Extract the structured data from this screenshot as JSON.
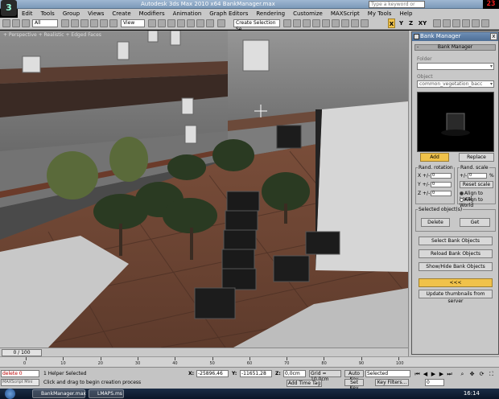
{
  "window": {
    "title": "Autodesk 3ds Max 2010 x64    BankManager.max",
    "search_placeholder": "Type a keyword or phrase",
    "frame_counter": "23"
  },
  "menu": [
    "Edit",
    "Tools",
    "Group",
    "Views",
    "Create",
    "Modifiers",
    "Animation",
    "Graph Editors",
    "Rendering",
    "Customize",
    "MAXScript",
    "My Tools",
    "Help"
  ],
  "toolbar": {
    "selection_filter": "All",
    "ref_coord": "View",
    "named_selection": "Create Selection Se",
    "axis_x": "X",
    "axis_y": "Y",
    "axis_z": "Z",
    "axis_xy": "XY"
  },
  "viewport": {
    "label": "+ Perspective + Realistic + Edged Faces"
  },
  "bank_manager": {
    "title": "Bank Manager",
    "close": "x",
    "rollout": "Bank Manager",
    "rollout_toggle": "-",
    "folder_label": "Folder",
    "folder_value": "",
    "object_label": "Object",
    "object_value": "common_vegetation_bacc",
    "add_button": "Add",
    "replace_button": "Replace",
    "rotation_group": "Rand. rotation",
    "rot_x_label": "X +/-",
    "rot_x": "0",
    "rot_y_label": "Y +/-",
    "rot_y": "0",
    "rot_z_label": "Z +/-",
    "rot_z": "0",
    "scale_group": "Rand. scale",
    "scale_label": "+/-",
    "scale_value": "0",
    "scale_unit": "%",
    "reset_scale": "Reset scale",
    "align_local": "Align to Local",
    "align_world": "Align to World",
    "selected_group": "Selected object(s)",
    "delete_button": "Delete",
    "get_button": "Get",
    "select_bank_objects": "Select Bank Objects",
    "reload_bank_objects": "Reload Bank Objects",
    "show_hide_bank_objects": "Show/Hide Bank Objects",
    "collapse_button": "<<<",
    "update_thumbnails": "Update thumbnails from server"
  },
  "timeline": {
    "time_label": "0 / 100",
    "ticks": [
      "0",
      "10",
      "20",
      "30",
      "40",
      "50",
      "60",
      "70",
      "80",
      "90",
      "100"
    ]
  },
  "status": {
    "selection_field": "delete 0",
    "script_field": "MAXScript Mini",
    "status_text": "1 Helper Selected",
    "prompt_text": "Click and drag to begin creation process",
    "x_label": "X:",
    "x_value": "-25896,46",
    "y_label": "Y:",
    "y_value": "-11651,28",
    "z_label": "Z:",
    "z_value": "0,0cm",
    "grid": "Grid = 10,0cm",
    "add_time_tag": "Add Time Tag",
    "auto_key": "Auto Key",
    "set_key": "Set Key",
    "selected_dropdown": "Selected",
    "key_filters": "Key Filters...",
    "frame_field": "0"
  },
  "taskbar": {
    "items": [
      "BankManager.max",
      "LMAPS.ms"
    ],
    "clock": "16:14"
  }
}
